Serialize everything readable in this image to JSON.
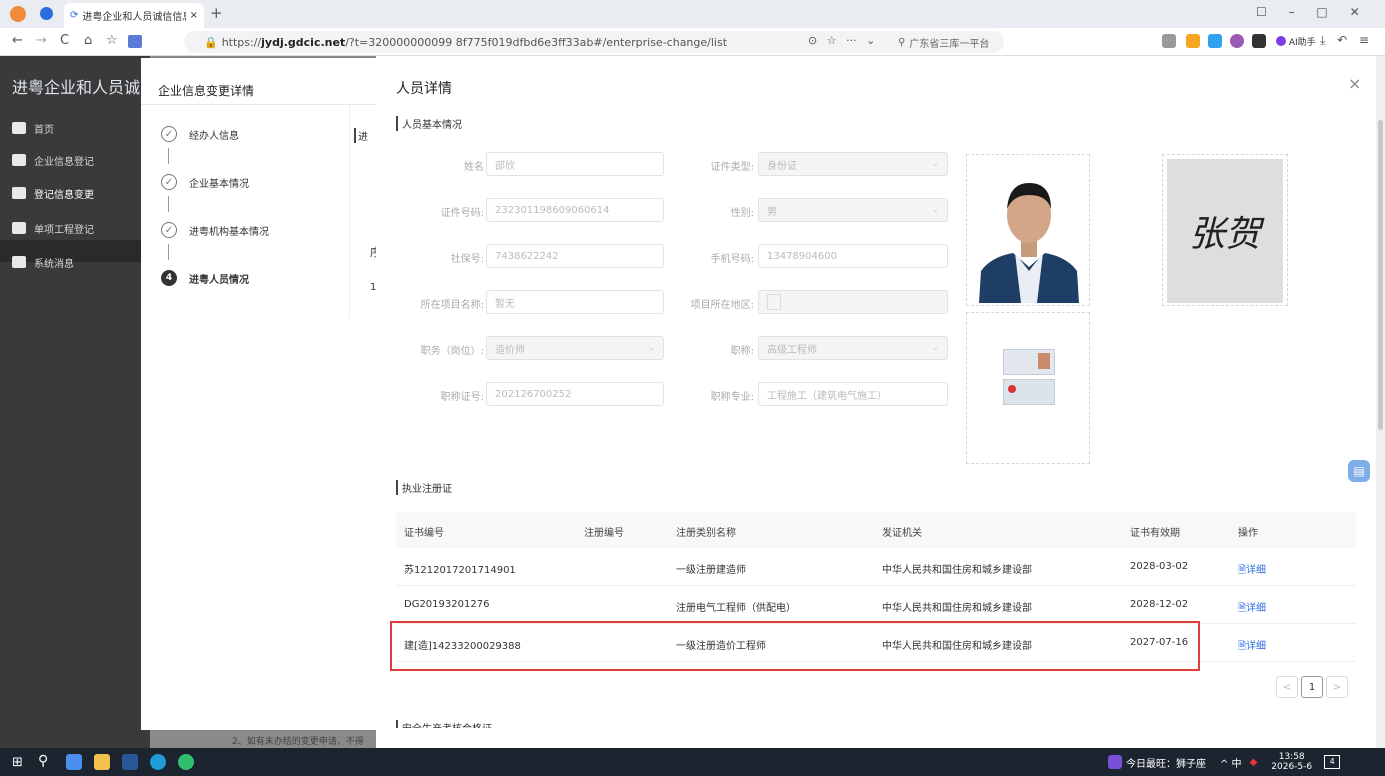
{
  "browser": {
    "tab_title": "进粤企业和人员诚信信息登记",
    "url_prefix": "https://",
    "url_domain": "jydj.gdcic.net",
    "url_rest": "/?t=320000000099 8f775f019dfbd6e3ff33ab#/enterprise-change/list",
    "search_text": "广东省三库一平台",
    "ai_label": "AI助手"
  },
  "sidebar": {
    "title": "进粤企业和人员诚",
    "items": [
      "首页",
      "企业信息登记",
      "登记信息变更",
      "单项工程登记",
      "系统消息"
    ]
  },
  "modal1": {
    "title": "企业信息变更详情",
    "steps": [
      "经办人信息",
      "企业基本情况",
      "进粤机构基本情况",
      "进粤人员情况"
    ],
    "step4_num": "4",
    "peek": [
      "进",
      "序",
      "1"
    ],
    "bottom_text": "2、如有未办结的变更申请，不得"
  },
  "drawer": {
    "title": "人员详情",
    "close": "×",
    "section_basic": "人员基本情况",
    "fields": {
      "name_label": "姓名",
      "name_value": "邵欣",
      "idtype_label": "证件类型:",
      "idtype_value": "身份证",
      "idno_label": "证件号码:",
      "idno_value": "232301198609060614",
      "sex_label": "性别:",
      "sex_value": "男",
      "social_label": "社保号:",
      "social_value": "7438622242",
      "phone_label": "手机号码:",
      "phone_value": "13478904600",
      "project_label": "所在项目名称:",
      "project_value": "暂无",
      "region_label": "项目所在地区:",
      "region_value": "",
      "post_label": "职务（岗位）:",
      "post_value": "造价师",
      "title_label": "职称:",
      "title_value": "高级工程师",
      "certno_label": "职称证号:",
      "certno_value": "202126700252",
      "major_label": "职称专业:",
      "major_value": "工程施工（建筑电气施工）"
    },
    "signature": "张贺",
    "section_reg": "执业注册证",
    "table_headers": [
      "证书编号",
      "注册编号",
      "注册类别名称",
      "发证机关",
      "证书有效期",
      "操作"
    ],
    "rows": [
      {
        "cert": "苏1212017201714901",
        "reg": "",
        "type": "一级注册建造师",
        "org": "中华人民共和国住房和城乡建设部",
        "valid": "2028-03-02",
        "op": "详细"
      },
      {
        "cert": "DG20193201276",
        "reg": "",
        "type": "注册电气工程师（供配电）",
        "org": "中华人民共和国住房和城乡建设部",
        "valid": "2028-12-02",
        "op": "详细"
      },
      {
        "cert": "建[造]14233200029388",
        "reg": "",
        "type": "一级注册造价工程师",
        "org": "中华人民共和国住房和城乡建设部",
        "valid": "2027-07-16",
        "op": "详细"
      }
    ],
    "page_prev": "<",
    "page_num": "1",
    "page_next": ">",
    "section_bottom": "安全生产考核合格证"
  },
  "taskbar": {
    "weather": "今日最旺：狮子座",
    "ime": "^ 中",
    "time": "13:58",
    "date": "2026-5-6",
    "notif": "4"
  },
  "colors": {
    "accent": "#2b6ce0",
    "highlight": "#e23b3b",
    "sidebar": "#3a3a3a"
  }
}
